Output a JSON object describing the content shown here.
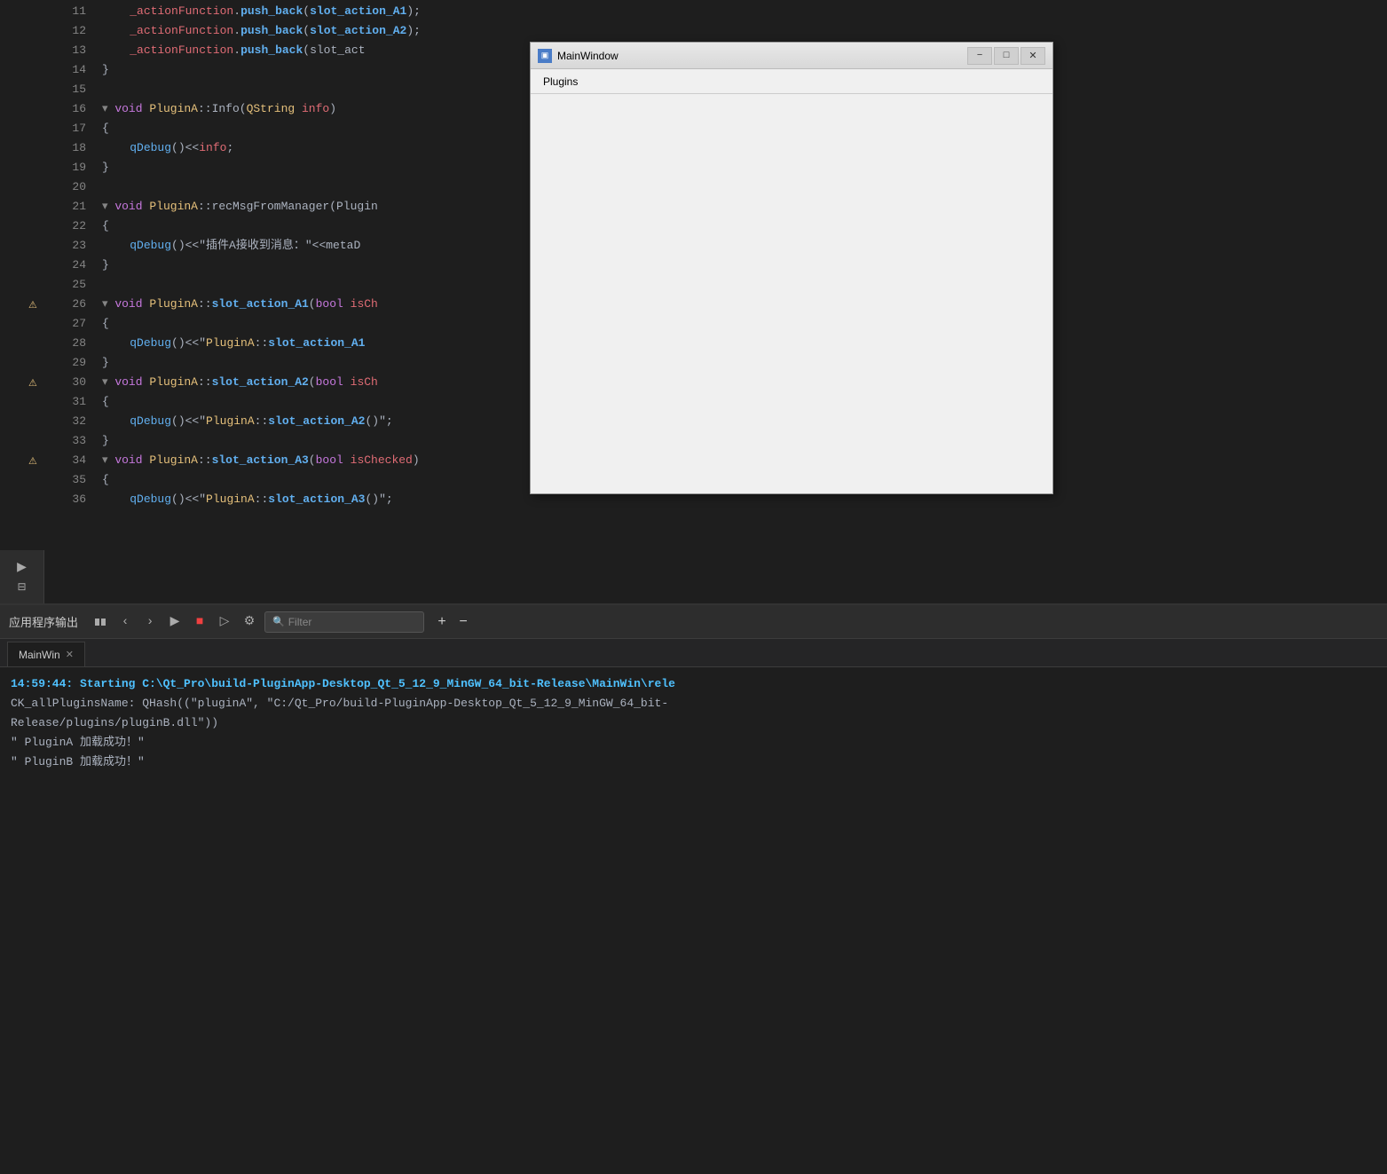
{
  "editor": {
    "lines": [
      {
        "num": "11",
        "content": "    _actionFunction.push_back(slot_action_A1);",
        "warn": false,
        "fold": false
      },
      {
        "num": "12",
        "content": "    _actionFunction.push_back(slot_action_A2);",
        "warn": false,
        "fold": false
      },
      {
        "num": "13",
        "content": "    _actionFunction.push_back(slot_act",
        "warn": false,
        "fold": false
      },
      {
        "num": "14",
        "content": "}",
        "warn": false,
        "fold": false
      },
      {
        "num": "15",
        "content": "",
        "warn": false,
        "fold": false
      },
      {
        "num": "16",
        "content": "void PluginA::Info(QString info)",
        "warn": false,
        "fold": true
      },
      {
        "num": "17",
        "content": "{",
        "warn": false,
        "fold": false
      },
      {
        "num": "18",
        "content": "    qDebug()<<info;",
        "warn": false,
        "fold": false
      },
      {
        "num": "19",
        "content": "}",
        "warn": false,
        "fold": false
      },
      {
        "num": "20",
        "content": "",
        "warn": false,
        "fold": false
      },
      {
        "num": "21",
        "content": "void PluginA::recMsgFromManager(Plugin",
        "warn": false,
        "fold": true
      },
      {
        "num": "22",
        "content": "{",
        "warn": false,
        "fold": false
      },
      {
        "num": "23",
        "content": "    qDebug()<<\"插件A接收到消息：\"<<metaD",
        "warn": false,
        "fold": false
      },
      {
        "num": "24",
        "content": "}",
        "warn": false,
        "fold": false
      },
      {
        "num": "25",
        "content": "",
        "warn": false,
        "fold": false
      },
      {
        "num": "26",
        "content": "void PluginA::slot_action_A1(bool isCh",
        "warn": true,
        "fold": true
      },
      {
        "num": "27",
        "content": "{",
        "warn": false,
        "fold": false
      },
      {
        "num": "28",
        "content": "    qDebug()<<\"PluginA::slot_action_A1",
        "warn": false,
        "fold": false
      },
      {
        "num": "29",
        "content": "}",
        "warn": false,
        "fold": false
      },
      {
        "num": "30",
        "content": "void PluginA::slot_action_A2(bool isCh",
        "warn": true,
        "fold": true
      },
      {
        "num": "31",
        "content": "{",
        "warn": false,
        "fold": false
      },
      {
        "num": "32",
        "content": "    qDebug()<<\"PluginA::slot_action_A2()\";",
        "warn": false,
        "fold": false
      },
      {
        "num": "33",
        "content": "}",
        "warn": false,
        "fold": false
      },
      {
        "num": "34",
        "content": "void PluginA::slot_action_A3(bool isChecked)",
        "warn": true,
        "fold": true
      },
      {
        "num": "35",
        "content": "{",
        "warn": false,
        "fold": false
      },
      {
        "num": "36",
        "content": "    qDebug()<<\"PluginA::slot_action_A3()\";",
        "warn": false,
        "fold": false
      }
    ]
  },
  "dialog": {
    "title": "MainWindow",
    "menu_items": [
      "Plugins"
    ],
    "close_btn": "✕",
    "minimize_btn": "−",
    "maximize_btn": "□"
  },
  "output_panel": {
    "title": "应用程序输出",
    "tab_name": "MainWin",
    "filter_placeholder": "Filter",
    "output_lines": [
      {
        "text": "14:59:44: Starting C:\\Qt_Pro\\build-PluginApp-Desktop_Qt_5_12_9_MinGW_64_bit-Release\\MainWin\\rele",
        "type": "blue"
      },
      {
        "text": "CK_allPluginsName:  QHash((\"pluginA\", \"C:/Qt_Pro/build-PluginApp-Desktop_Qt_5_12_9_MinGW_64_bit-",
        "type": "normal"
      },
      {
        "text": "Release/plugins/pluginB.dll\"))",
        "type": "normal"
      },
      {
        "text": "\" PluginA 加载成功！\"",
        "type": "normal"
      },
      {
        "text": "\" PluginB 加载成功！\"",
        "type": "normal"
      }
    ]
  }
}
